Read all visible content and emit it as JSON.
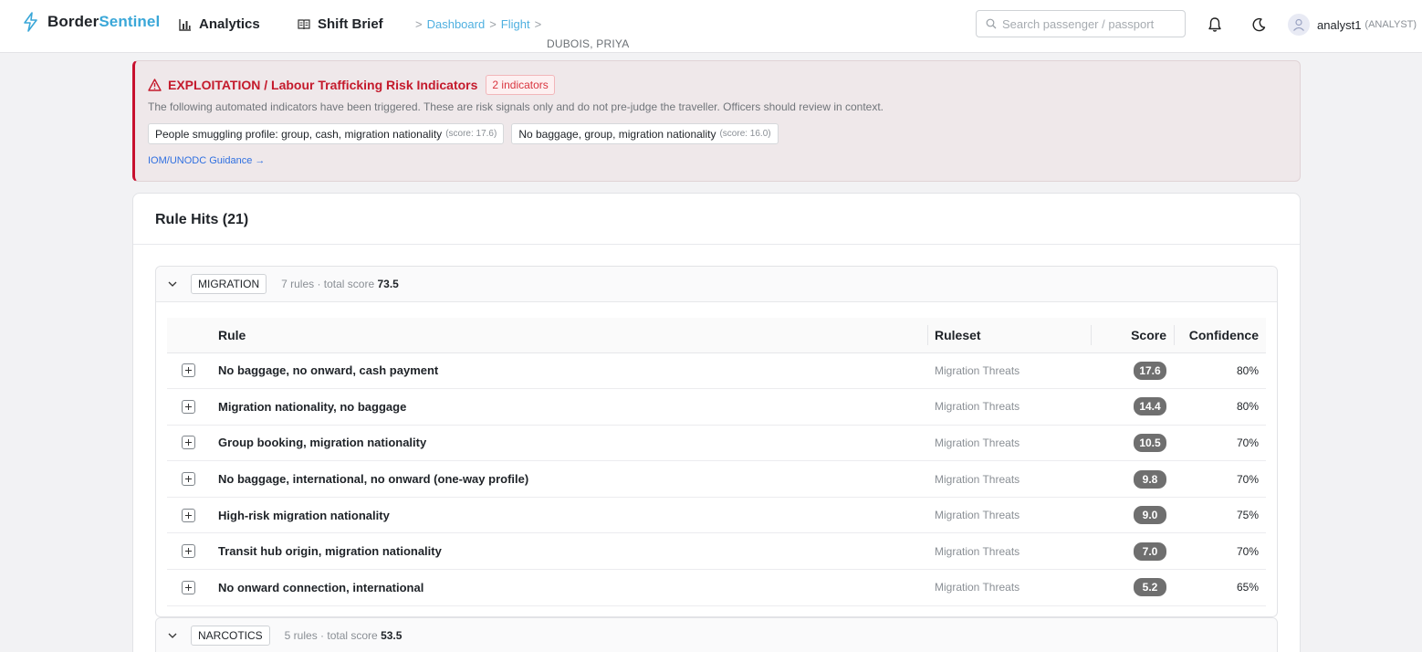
{
  "app": {
    "brand_part1": "Border",
    "brand_part2": "Sentinel",
    "accent_color": "#3aa7d8"
  },
  "nav": {
    "analytics_label": "Analytics",
    "shift_brief_label": "Shift Brief"
  },
  "breadcrumb": {
    "items": [
      "Dashboard",
      "Flight"
    ],
    "current": "DUBOIS, PRIYA"
  },
  "search": {
    "placeholder": "Search passenger / passport",
    "value": ""
  },
  "user": {
    "name": "analyst1",
    "role": "(ANALYST)"
  },
  "alert": {
    "title": "EXPLOITATION / Labour Trafficking Risk Indicators",
    "count_label": "2 indicators",
    "description": "The following automated indicators have been triggered. These are risk signals only and do not pre-judge the traveller. Officers should review in context.",
    "tags": [
      {
        "label": "People smuggling profile: group, cash, migration nationality",
        "score": "(score: 17.6)"
      },
      {
        "label": "No baggage, group, migration nationality",
        "score": "(score: 16.0)"
      }
    ],
    "link_label": "IOM/UNODC Guidance →",
    "color": "#c41a2c"
  },
  "rule_hits": {
    "title": "Rule Hits (21)",
    "columns": {
      "rule": "Rule",
      "ruleset": "Ruleset",
      "score": "Score",
      "confidence": "Confidence"
    },
    "groups": [
      {
        "name": "MIGRATION",
        "meta_prefix": "7 rules · total score",
        "total": "73.5",
        "expanded": true,
        "rows": [
          {
            "rule": "No baggage, no onward, cash payment",
            "ruleset": "Migration Threats",
            "score": "17.6",
            "confidence": "80%"
          },
          {
            "rule": "Migration nationality, no baggage",
            "ruleset": "Migration Threats",
            "score": "14.4",
            "confidence": "80%"
          },
          {
            "rule": "Group booking, migration nationality",
            "ruleset": "Migration Threats",
            "score": "10.5",
            "confidence": "70%"
          },
          {
            "rule": "No baggage, international, no onward (one-way profile)",
            "ruleset": "Migration Threats",
            "score": "9.8",
            "confidence": "70%"
          },
          {
            "rule": "High-risk migration nationality",
            "ruleset": "Migration Threats",
            "score": "9.0",
            "confidence": "75%"
          },
          {
            "rule": "Transit hub origin, migration nationality",
            "ruleset": "Migration Threats",
            "score": "7.0",
            "confidence": "70%"
          },
          {
            "rule": "No onward connection, international",
            "ruleset": "Migration Threats",
            "score": "5.2",
            "confidence": "65%"
          }
        ]
      },
      {
        "name": "NARCOTICS",
        "meta_prefix": "5 rules · total score",
        "total": "53.5",
        "expanded": false,
        "rows": []
      }
    ]
  }
}
